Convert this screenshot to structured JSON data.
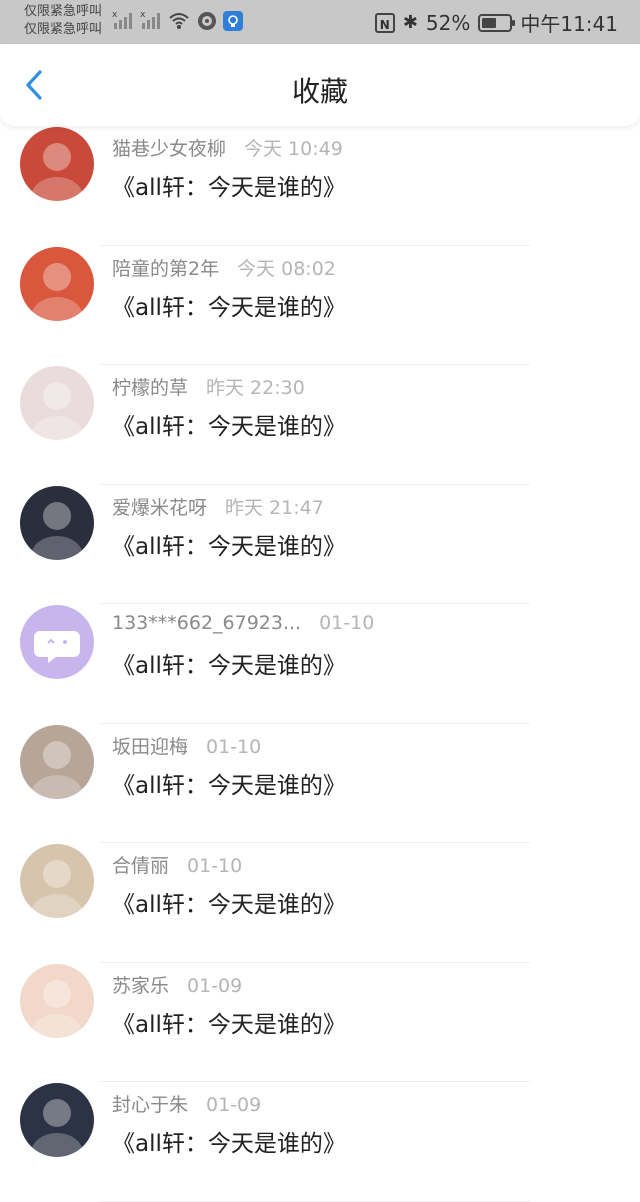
{
  "status_bar": {
    "carrier_line1": "仅限紧急呼叫",
    "carrier_line2": "仅限紧急呼叫",
    "battery": "52%",
    "battery_level": 0.52,
    "time": "中午11:41",
    "nfc_label": "N",
    "bluetooth_glyph": "✱"
  },
  "header": {
    "title": "收藏"
  },
  "items": [
    {
      "name": "猫巷少女夜柳",
      "time": "今天 10:49",
      "text": "《all轩：今天是谁的》",
      "avatar_color": "#c94a3a",
      "avatar_icon": "avatar-red-hat"
    },
    {
      "name": "陪童的第2年",
      "time": "今天 08:02",
      "text": "《all轩：今天是谁的》",
      "avatar_color": "#d9573d",
      "avatar_icon": "avatar-red-hood"
    },
    {
      "name": "柠檬的草",
      "time": "昨天 22:30",
      "text": "《all轩：今天是谁的》",
      "avatar_color": "#eadcdc",
      "avatar_icon": "avatar-white-hair"
    },
    {
      "name": "爱爆米花呀",
      "time": "昨天 21:47",
      "text": "《all轩：今天是谁的》",
      "avatar_color": "#2b2f3d",
      "avatar_icon": "avatar-photo-girl"
    },
    {
      "name": "133***662_67923...",
      "time": "01-10",
      "text": "《all轩：今天是谁的》",
      "avatar_color": "#c9b5ee",
      "avatar_icon": "avatar-default-chat"
    },
    {
      "name": "坂田迎梅",
      "time": "01-10",
      "text": "《all轩：今天是谁的》",
      "avatar_color": "#b7a597",
      "avatar_icon": "avatar-photo-child"
    },
    {
      "name": "合倩丽",
      "time": "01-10",
      "text": "《all轩：今天是谁的》",
      "avatar_color": "#d7c4ad",
      "avatar_icon": "avatar-puppy"
    },
    {
      "name": "苏家乐",
      "time": "01-09",
      "text": "《all轩：今天是谁的》",
      "avatar_color": "#f2d8c8",
      "avatar_icon": "avatar-drawn-girl"
    },
    {
      "name": "封心于朱",
      "time": "01-09",
      "text": "《all轩：今天是谁的》",
      "avatar_color": "#2c3344",
      "avatar_icon": "avatar-photo-dark"
    }
  ]
}
